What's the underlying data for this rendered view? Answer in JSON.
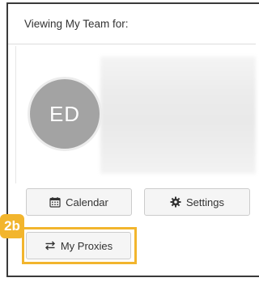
{
  "header": {
    "title": "Viewing My Team for:"
  },
  "profile": {
    "initials": "ED",
    "name_obscured": true
  },
  "buttons": {
    "calendar_label": "Calendar",
    "settings_label": "Settings",
    "proxies_label": "My Proxies"
  },
  "annotation": {
    "step_label": "2b",
    "highlight_color": "#f2b52d"
  },
  "icons": {
    "calendar": "calendar-icon",
    "settings": "gear-icon",
    "proxies": "swap-arrows-icon"
  },
  "colors": {
    "avatar_bg": "#a3a3a3",
    "button_bg": "#f5f5f5",
    "border_dark": "#3a3a3a"
  }
}
